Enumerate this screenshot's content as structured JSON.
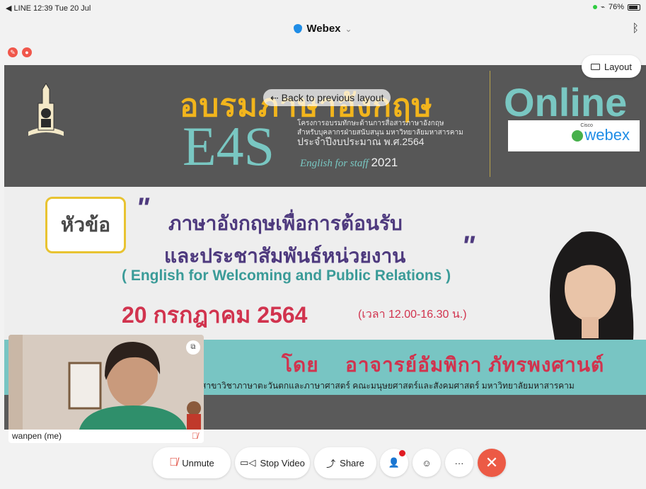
{
  "status_bar": {
    "left": "◀ LINE  12:39  Tue 20 Jul",
    "battery": "76%"
  },
  "app_title": "Webex",
  "slide": {
    "header_thai": "อบรมภาษาอังกฤษ",
    "e4s": "E4S",
    "project_line1": "โครงการอบรมทักษะด้านการสื่อสารภาษาอังกฤษ",
    "project_line2": "สำหรับบุคลากรฝ่ายสนับสนุน มหาวิทยาลัยมหาสารคาม",
    "project_line3": "ประจำปีงบประมาณ พ.ศ.2564",
    "english_for_staff": "English for staff",
    "english_year": "2021",
    "online": "Online",
    "cisco": "Cisco",
    "webex": "webex",
    "topic_label": "หัวข้อ",
    "topic_line1": "ภาษาอังกฤษเพื่อการต้อนรับ",
    "topic_line2": "และประชาสัมพันธ์หน่วยงาน",
    "topic_english": "( English for Welcoming and Public Relations )",
    "date": "20 กรกฎาคม 2564",
    "time": "(เวลา 12.00-16.30 น.)",
    "by": "โดย",
    "lecturer": "อาจารย์อัมพิกา  ภัทรพงศานต์",
    "department": "สาขาวิชาภาษาตะวันตกและภาษาศาสตร์ คณะมนุษยศาสตร์และสังคมศาสตร์ มหาวิทยาลัยมหาสารคาม"
  },
  "back_button": "Back to previous layout",
  "layout_button": "Layout",
  "self_view": {
    "name": "wanpen (me)"
  },
  "controls": {
    "unmute": "Unmute",
    "stop_video": "Stop Video",
    "share": "Share",
    "more": "···",
    "leave": "✕"
  }
}
